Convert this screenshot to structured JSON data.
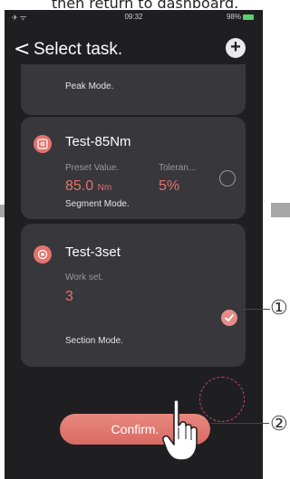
{
  "caption": "then return to dashboard.",
  "status_bar": {
    "time": "09:32",
    "battery": "98%"
  },
  "header": {
    "back_symbol": "<",
    "title": "Select task.",
    "add_symbol": "+"
  },
  "tasks": [
    {
      "mode": "Peak Mode."
    },
    {
      "name": "Test-85Nm",
      "label1": "Preset Value.",
      "value1": "85.0",
      "unit1": "Nm",
      "label2": "Toleran...",
      "value2": "5%",
      "mode": "Segment Mode.",
      "selected": false
    },
    {
      "name": "Test-3set",
      "label1": "Work set.",
      "value1": "3",
      "mode": "Section Mode.",
      "selected": true
    }
  ],
  "confirm_label": "Confirm.",
  "callouts": [
    "①",
    "②"
  ],
  "colors": {
    "accent": "#e5736c",
    "card": "#37373c",
    "screen": "#1f1f22",
    "highlight_dash": "#c9426c"
  },
  "icons": [
    "back-arrow-icon",
    "add-icon",
    "task-icon",
    "radio-icon",
    "checkmark-icon",
    "pointing-hand-icon",
    "arrow-left-icon",
    "arrow-right-icon"
  ]
}
